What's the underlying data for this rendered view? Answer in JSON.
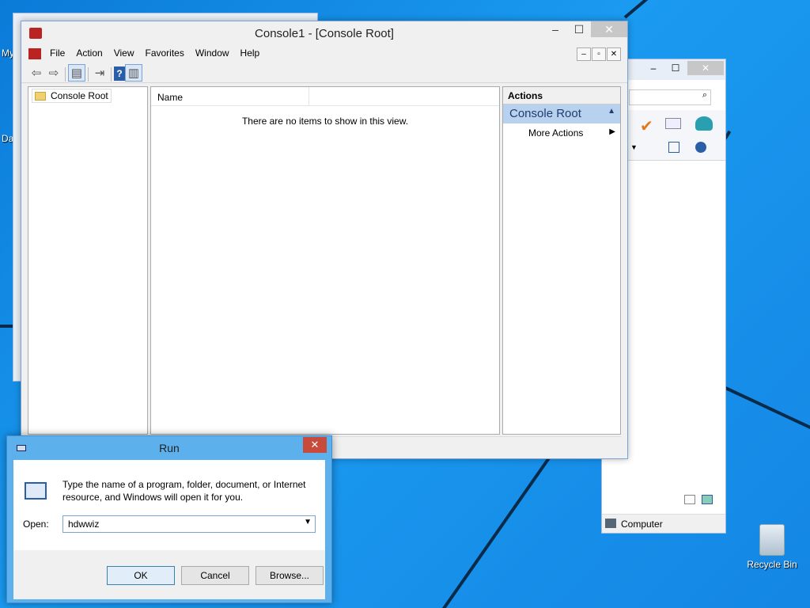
{
  "desktop": {
    "labels": [
      "My",
      "Da"
    ],
    "recycle_bin_label": "Recycle Bin"
  },
  "explorer_window": {
    "status_text": "Computer",
    "minimize_glyph": "–",
    "maximize_glyph": "☐",
    "close_glyph": "✕",
    "search_icon": "search-icon"
  },
  "mmc": {
    "title": "Console1 - [Console Root]",
    "minimize_glyph": "–",
    "maximize_glyph": "☐",
    "close_glyph": "✕",
    "menu": [
      "File",
      "Action",
      "View",
      "Favorites",
      "Window",
      "Help"
    ],
    "mdi_buttons": [
      "–",
      "▫",
      "✕"
    ],
    "toolbar": {
      "back_glyph": "⇦",
      "forward_glyph": "⇨",
      "help_glyph": "?"
    },
    "tree": {
      "root_label": "Console Root"
    },
    "list": {
      "column_name": "Name",
      "empty_message": "There are no items to show in this view."
    },
    "actions": {
      "header": "Actions",
      "selected": "Console Root",
      "more": "More Actions"
    }
  },
  "run_dialog": {
    "title": "Run",
    "close_glyph": "✕",
    "description": "Type the name of a program, folder, document, or Internet resource, and Windows will open it for you.",
    "open_label": "Open:",
    "open_value": "hdwwiz",
    "buttons": {
      "ok": "OK",
      "cancel": "Cancel",
      "browse": "Browse..."
    }
  },
  "colors": {
    "desktop": "#1a8fe6",
    "run_frame": "#5cb0ec",
    "close_red": "#c74a3a",
    "action_selected": "#b7d1ee"
  }
}
